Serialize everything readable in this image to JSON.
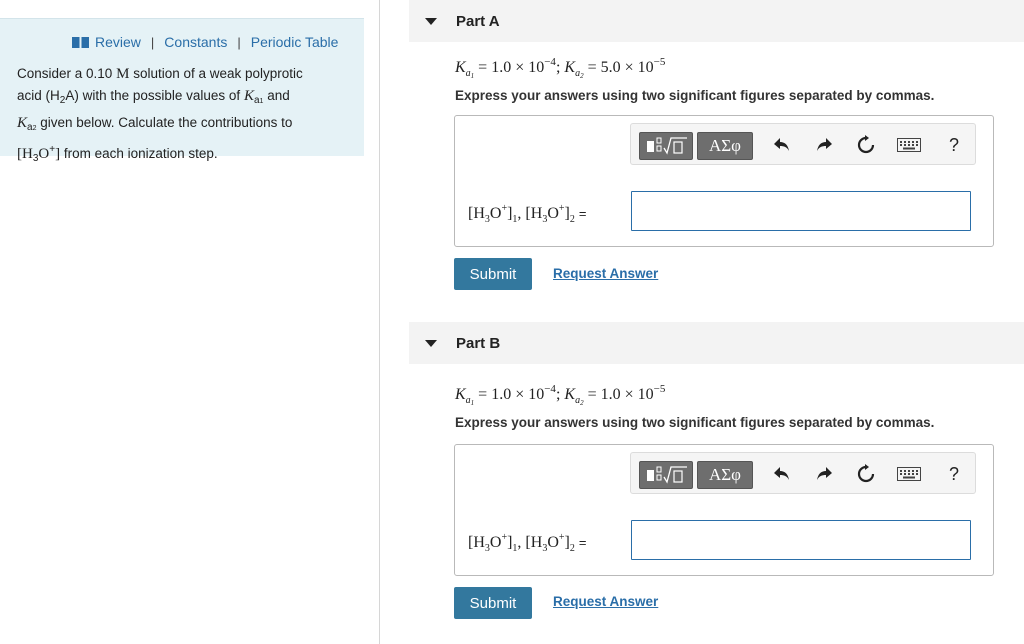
{
  "sidebar": {
    "links": {
      "review": "Review",
      "constants": "Constants",
      "periodic_table": "Periodic Table"
    },
    "problem": {
      "t1": "Consider a 0.10",
      "t2": "M",
      "t3": "solution of a weak polyprotic",
      "t4": "acid (H",
      "t5": "2",
      "t6": "A) with the possible values of",
      "t7": "K",
      "t8": "a",
      "t9": "1",
      "t10": "and",
      "t11": "K",
      "t12": "a",
      "t13": "2",
      "t14": "given below. Calculate the contributions to",
      "t15": "[H",
      "t16": "3",
      "t17": "O",
      "t18": "+",
      "t19": "]",
      "t20": "from each ionization step."
    }
  },
  "parts": [
    {
      "title": "Part A",
      "ka1": "= 1.0 × 10",
      "ka1_exp": "−4",
      "ka2": "= 5.0 × 10",
      "ka2_exp": "−5",
      "instruction": "Express your answers using two significant figures separated by commas.",
      "input_value": "",
      "submit": "Submit",
      "request": "Request Answer"
    },
    {
      "title": "Part B",
      "ka1": "= 1.0 × 10",
      "ka1_exp": "−4",
      "ka2": "= 1.0 × 10",
      "ka2_exp": "−5",
      "instruction": "Express your answers using two significant figures separated by commas.",
      "input_value": "",
      "submit": "Submit",
      "request": "Request Answer"
    }
  ],
  "math": {
    "K": "K",
    "a": "a",
    "one": "1",
    "two": "2",
    "semi": ";",
    "h3o_open": "[H",
    "three": "3",
    "o": "O",
    "plus": "+",
    "close": "]",
    "comma": ",",
    "equals": "="
  },
  "toolbar": {
    "greek": "ΑΣφ",
    "help": "?",
    "icons": [
      "templates-icon",
      "greek-symbols-icon",
      "undo-icon",
      "redo-icon",
      "reset-icon",
      "keyboard-icon",
      "help-icon"
    ]
  }
}
